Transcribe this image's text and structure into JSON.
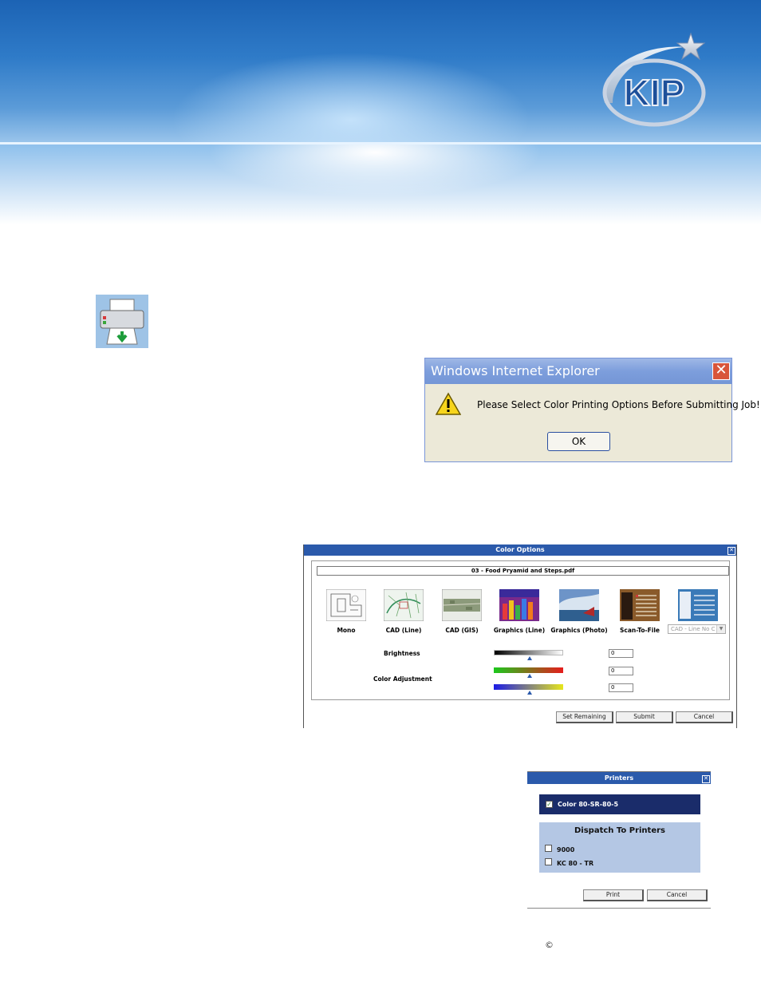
{
  "brand": {
    "logo_text": "KIP"
  },
  "ie_dialog": {
    "title": "Windows Internet Explorer",
    "message": "Please Select Color Printing Options Before Submitting Job!",
    "ok_label": "OK"
  },
  "color_options": {
    "title": "Color Options",
    "file_name": "03 - Food Pryamid and Steps.pdf",
    "presets": [
      {
        "label": "Mono"
      },
      {
        "label": "CAD (Line)"
      },
      {
        "label": "CAD (GIS)"
      },
      {
        "label": "Graphics (Line)"
      },
      {
        "label": "Graphics (Photo)"
      },
      {
        "label": "Scan-To-File"
      }
    ],
    "preset_select": "CAD - Line No C",
    "brightness_label": "Brightness",
    "color_adjustment_label": "Color Adjustment",
    "brightness_value": "0",
    "color1_value": "0",
    "color2_value": "0",
    "set_remaining_label": "Set Remaining",
    "submit_label": "Submit",
    "cancel_label": "Cancel"
  },
  "printers": {
    "title": "Printers",
    "selected_printer": "Color 80-SR-80-5",
    "dispatch_title": "Dispatch To Printers",
    "dispatch_items": [
      {
        "label": "9000"
      },
      {
        "label": "KC 80 - TR"
      }
    ],
    "print_label": "Print",
    "cancel_label": "Cancel"
  },
  "footer": {
    "copyright": "©"
  },
  "colors": {
    "title_bar": "#2b5aab",
    "banner_blue": "#1c63b4",
    "selected_row": "#1a2c6a",
    "dispatch_bg": "#b4c7e4"
  }
}
